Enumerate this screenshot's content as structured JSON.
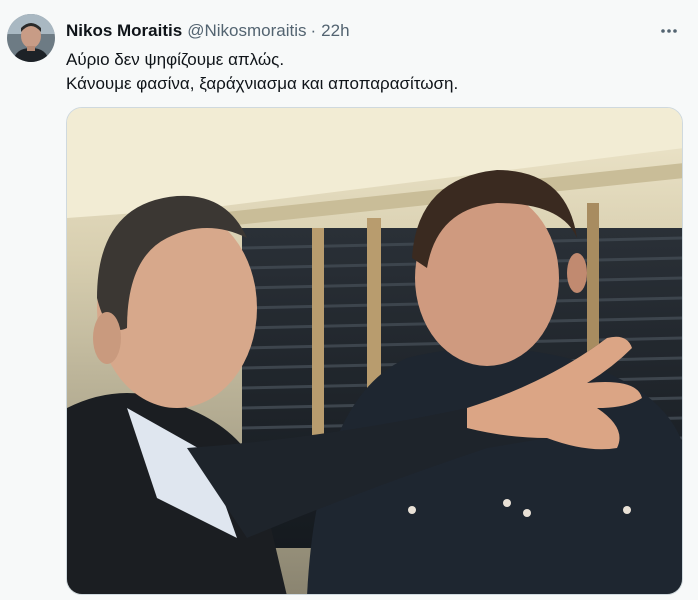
{
  "tweet": {
    "author_name": "Nikos Moraitis",
    "author_handle": "@Nikosmoraitis",
    "separator": "·",
    "time": "22h",
    "text_lines": [
      "Αύριο δεν ψηφίζουμε απλώς.",
      "Κάνουμε φασίνα, ξαράχνιασμα και αποπαρασίτωση."
    ],
    "more_icon": "more-horizontal-icon"
  },
  "colors": {
    "name": "#0f1419",
    "meta": "#536471",
    "background": "#f7f9f9"
  }
}
